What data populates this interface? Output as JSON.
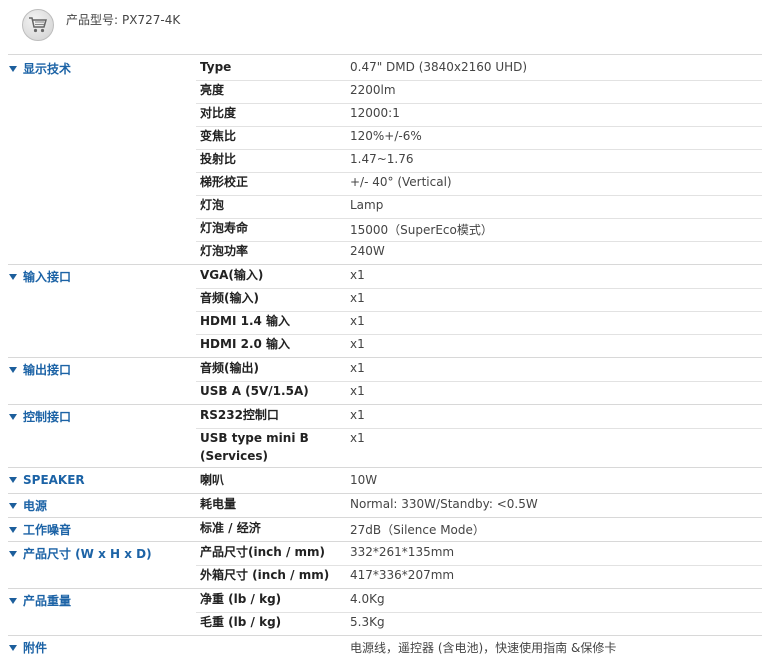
{
  "header": {
    "model_label": "产品型号:",
    "model_value": "PX727-4K",
    "icon": "shopping-cart-icon"
  },
  "categories": [
    {
      "name": "显示技术",
      "rows": [
        {
          "label": "Type",
          "value": "0.47\" DMD (3840x2160 UHD)"
        },
        {
          "label": "亮度",
          "value": "2200lm"
        },
        {
          "label": "对比度",
          "value": "12000:1"
        },
        {
          "label": "变焦比",
          "value": "120%+/-6%"
        },
        {
          "label": "投射比",
          "value": "1.47~1.76"
        },
        {
          "label": "梯形校正",
          "value": "+/- 40° (Vertical)"
        },
        {
          "label": "灯泡",
          "value": "Lamp"
        },
        {
          "label": "灯泡寿命",
          "value": "15000（SuperEco模式）"
        },
        {
          "label": "灯泡功率",
          "value": "240W"
        }
      ]
    },
    {
      "name": "输入接口",
      "rows": [
        {
          "label": "VGA(输入)",
          "value": "x1"
        },
        {
          "label": "音频(输入)",
          "value": "x1"
        },
        {
          "label": "HDMI 1.4 输入",
          "value": "x1"
        },
        {
          "label": "HDMI 2.0 输入",
          "value": "x1"
        }
      ]
    },
    {
      "name": "输出接口",
      "rows": [
        {
          "label": "音频(输出)",
          "value": "x1"
        },
        {
          "label": "USB A (5V/1.5A)",
          "value": "x1"
        }
      ]
    },
    {
      "name": "控制接口",
      "rows": [
        {
          "label": "RS232控制口",
          "value": "x1"
        },
        {
          "label": "USB type mini B (Services)",
          "value": "x1"
        }
      ]
    },
    {
      "name": "SPEAKER",
      "rows": [
        {
          "label": "喇叭",
          "value": "10W"
        }
      ]
    },
    {
      "name": "电源",
      "rows": [
        {
          "label": "耗电量",
          "value": "Normal: 330W/Standby: <0.5W"
        }
      ]
    },
    {
      "name": "工作噪音",
      "rows": [
        {
          "label": "标准 / 经济",
          "value": "27dB（Silence Mode）"
        }
      ]
    },
    {
      "name": "产品尺寸 (W x H x D)",
      "rows": [
        {
          "label": "产品尺寸(inch / mm)",
          "value": "332*261*135mm"
        },
        {
          "label": "外箱尺寸 (inch / mm)",
          "value": "417*336*207mm"
        }
      ]
    },
    {
      "name": "产品重量",
      "rows": [
        {
          "label": "净重 (lb / kg)",
          "value": "4.0Kg"
        },
        {
          "label": "毛重 (lb / kg)",
          "value": "5.3Kg"
        }
      ]
    },
    {
      "name": "附件",
      "rows": [
        {
          "label": "",
          "value": "电源线，遥控器 (含电池)，快速使用指南 &保修卡"
        }
      ]
    }
  ]
}
